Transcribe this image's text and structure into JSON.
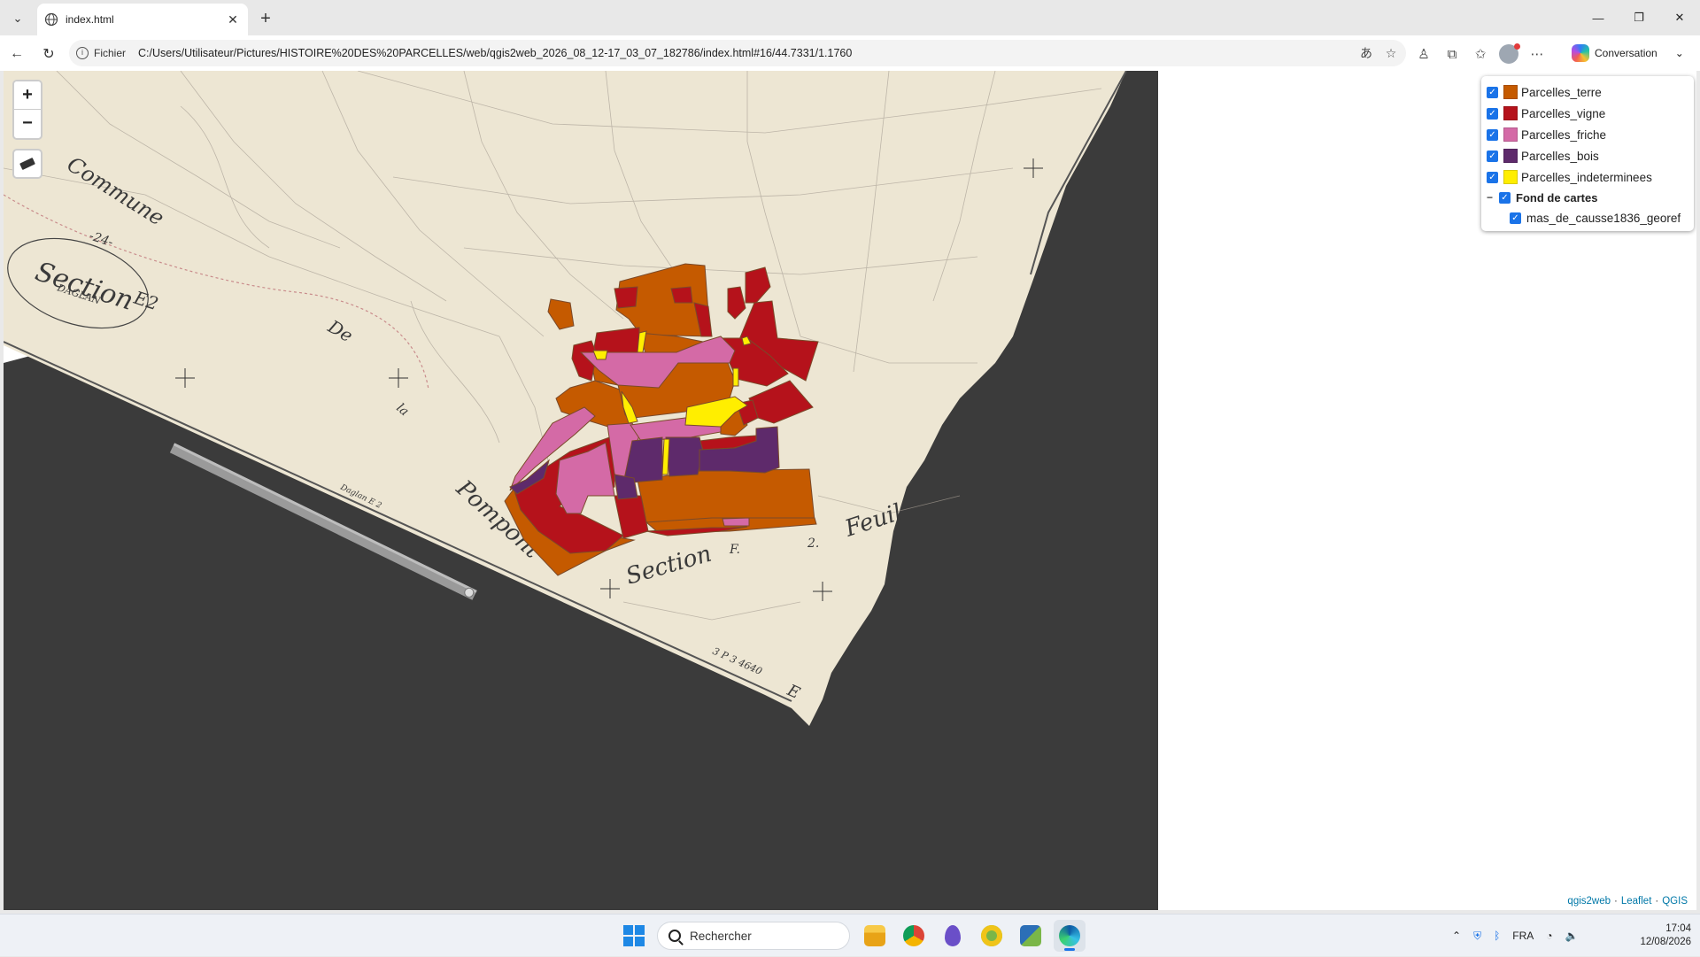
{
  "browser": {
    "tab_title": "index.html",
    "new_tab_symbol": "+",
    "address_scheme": "Fichier",
    "url": "C:/Users/Utilisateur/Pictures/HISTOIRE%20DES%20PARCELLES/web/qgis2web_2026_08_12-17_03_07_182786/index.html#16/44.7331/1.1760",
    "copilot_label": "Conversation"
  },
  "map": {
    "zoom_in": "+",
    "zoom_out": "−",
    "attribution": {
      "qgis2web": "qgis2web",
      "leaflet": "Leaflet",
      "qgis": "QGIS",
      "sep": "·"
    },
    "labels": {
      "commune": "Commune",
      "section_num": "-24-",
      "section_title": "Section",
      "section_code": "E2",
      "daglan": "DAGLAN",
      "de": "De",
      "la": "la",
      "pompont": "Pompont",
      "section_f": "Section",
      "f_letter": "F.",
      "f_num": "2.",
      "feuill": "Feuil",
      "ref_3p3": "3 P 3  4640",
      "e_bottom": "E",
      "daglan_e2": "Daglan E 2"
    }
  },
  "layers_panel": {
    "layers": [
      {
        "name": "Parcelles_terre",
        "color": "#c55a00"
      },
      {
        "name": "Parcelles_vigne",
        "color": "#b5121b"
      },
      {
        "name": "Parcelles_friche",
        "color": "#d46aa6"
      },
      {
        "name": "Parcelles_bois",
        "color": "#5e2a6b"
      },
      {
        "name": "Parcelles_indeterminees",
        "color": "#ffee00"
      }
    ],
    "group": {
      "toggle": "−",
      "name": "Fond de cartes"
    },
    "basemap": "mas_de_causse1836_georef"
  },
  "taskbar": {
    "search_placeholder": "Rechercher",
    "lang": "FRA",
    "time": "17:04",
    "date": "12/08/2026"
  },
  "colors": {
    "terre": "#c55a00",
    "vigne": "#b5121b",
    "friche": "#d46aa6",
    "bois": "#5e2a6b",
    "indet": "#ffee00",
    "parchment": "#ede6d3",
    "outside": "#3b3b3b"
  }
}
